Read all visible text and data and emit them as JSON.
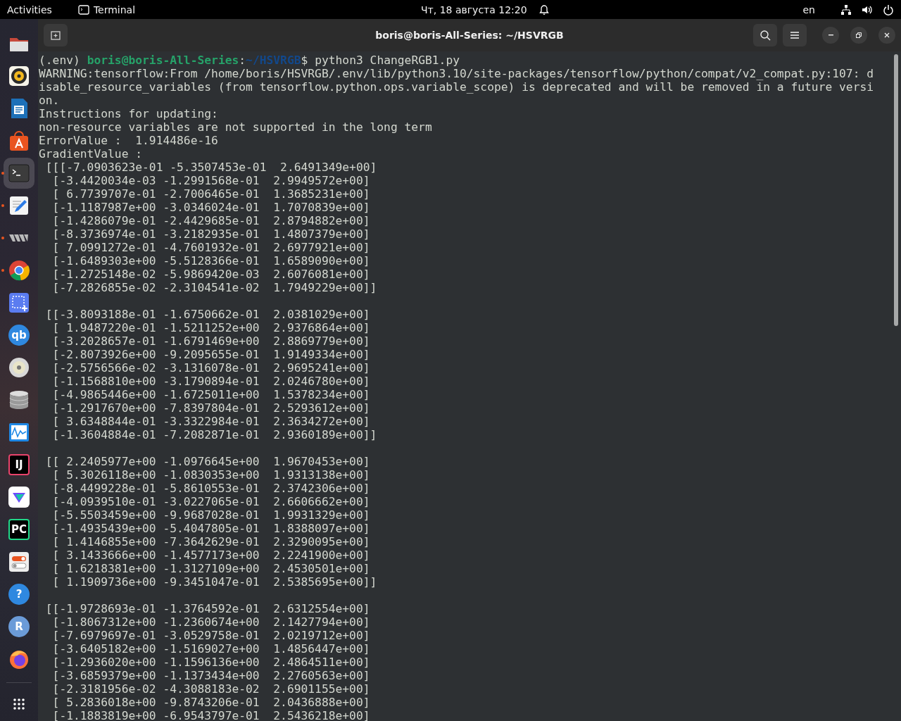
{
  "top_bar": {
    "activities": "Activities",
    "app_menu": "Terminal",
    "clock": "Чт, 18 августа  12:20",
    "keyboard_layout": "en"
  },
  "dock": {
    "items": [
      {
        "kind": "files",
        "running": false,
        "selected": false
      },
      {
        "kind": "music",
        "running": false,
        "selected": false
      },
      {
        "kind": "writer",
        "running": false,
        "selected": false
      },
      {
        "kind": "store",
        "running": false,
        "selected": false
      },
      {
        "kind": "terminal",
        "running": true,
        "selected": true
      },
      {
        "kind": "editor",
        "running": true,
        "selected": false
      },
      {
        "kind": "vm",
        "running": true,
        "selected": false
      },
      {
        "kind": "browser",
        "running": true,
        "selected": false
      },
      {
        "kind": "screenshot",
        "running": false,
        "selected": false
      },
      {
        "kind": "badge",
        "label": "qb",
        "running": false,
        "selected": false
      },
      {
        "kind": "disc",
        "running": false,
        "selected": false
      },
      {
        "kind": "database",
        "running": false,
        "selected": false
      },
      {
        "kind": "monitor",
        "running": false,
        "selected": false
      },
      {
        "kind": "ide",
        "label": "IJ",
        "running": false,
        "selected": false
      },
      {
        "kind": "vpn",
        "running": false,
        "selected": false
      },
      {
        "kind": "ide-green",
        "label": "PC",
        "running": false,
        "selected": false
      },
      {
        "kind": "toggles",
        "running": false,
        "selected": false
      },
      {
        "kind": "badge",
        "label": "?",
        "running": false,
        "selected": false
      },
      {
        "kind": "badge-light",
        "label": "R",
        "running": false,
        "selected": false
      },
      {
        "kind": "firefox",
        "running": false,
        "selected": false
      }
    ]
  },
  "window": {
    "title": "boris@boris-All-Series: ~/HSVRGB"
  },
  "terminal": {
    "prompt": {
      "env": "(.env)",
      "user_host": "boris@boris-All-Series",
      "separator": ":",
      "path": "~/HSVRGB",
      "symbol": "$",
      "command": "python3 ChangeRGB1.py"
    },
    "output": [
      "WARNING:tensorflow:From /home/boris/HSVRGB/.env/lib/python3.10/site-packages/tensorflow/python/compat/v2_compat.py:107: d",
      "isable_resource_variables (from tensorflow.python.ops.variable_scope) is deprecated and will be removed in a future versi",
      "on.",
      "Instructions for updating:",
      "non-resource variables are not supported in the long term",
      "ErrorValue :  1.914486e-16",
      "GradientValue :"
    ],
    "matrices": [
      [
        " [[[-7.0903623e-01 -5.3507453e-01  2.6491349e+00]",
        "  [-3.4420034e-03 -1.2991568e-01  2.9949572e+00]",
        "  [ 6.7739707e-01 -2.7006465e-01  1.3685231e+00]",
        "  [-1.1187987e+00 -3.0346024e-01  1.7070839e+00]",
        "  [-1.4286079e-01 -2.4429685e-01  2.8794882e+00]",
        "  [-8.3736974e-01 -3.2182935e-01  1.4807379e+00]",
        "  [ 7.0991272e-01 -4.7601932e-01  2.6977921e+00]",
        "  [-1.6489303e+00 -5.5128366e-01  1.6589090e+00]",
        "  [-1.2725148e-02 -5.9869420e-03  2.6076081e+00]",
        "  [-7.2826855e-02 -2.3104541e-02  1.7949229e+00]]"
      ],
      [
        " [[-3.8093188e-01 -1.6750662e-01  2.0381029e+00]",
        "  [ 1.9487220e-01 -1.5211252e+00  2.9376864e+00]",
        "  [-3.2028657e-01 -1.6791469e+00  2.8869779e+00]",
        "  [-2.8073926e+00 -9.2095655e-01  1.9149334e+00]",
        "  [-2.5756566e-02 -3.1316078e-01  2.9695241e+00]",
        "  [-1.1568810e+00 -3.1790894e-01  2.0246780e+00]",
        "  [-4.9865446e+00 -1.6725011e+00  1.5378234e+00]",
        "  [-1.2917670e+00 -7.8397804e-01  2.5293612e+00]",
        "  [ 3.6348844e-01 -3.3322984e-01  2.3634272e+00]",
        "  [-1.3604884e-01 -7.2082871e-01  2.9360189e+00]]"
      ],
      [
        " [[ 2.2405977e+00 -1.0976645e+00  1.9670453e+00]",
        "  [ 5.3026118e+00 -1.0830353e+00  1.9313138e+00]",
        "  [-8.4499228e-01 -5.8610553e-01  2.3742306e+00]",
        "  [-4.0939510e-01 -3.0227065e-01  2.6606662e+00]",
        "  [-5.5503459e+00 -9.9687028e-01  1.9931329e+00]",
        "  [-1.4935439e+00 -5.4047805e-01  1.8388097e+00]",
        "  [ 1.4146855e+00 -7.3642629e-01  2.3290095e+00]",
        "  [ 3.1433666e+00 -1.4577173e+00  2.2241900e+00]",
        "  [ 1.6218381e+00 -1.3127109e+00  2.4530501e+00]",
        "  [ 1.1909736e+00 -9.3451047e-01  2.5385695e+00]]"
      ],
      [
        " [[-1.9728693e-01 -1.3764592e-01  2.6312554e+00]",
        "  [-1.8067312e+00 -1.2360674e+00  2.1427794e+00]",
        "  [-7.6979697e-01 -3.0529758e-01  2.0219712e+00]",
        "  [-3.6405182e+00 -1.5169027e+00  1.4856447e+00]",
        "  [-1.2936020e+00 -1.1596136e+00  2.4864511e+00]",
        "  [-3.6859379e+00 -1.1373434e+00  2.2760563e+00]",
        "  [-2.3181956e-02 -4.3088183e-02  2.6901155e+00]",
        "  [ 5.2836018e+00 -9.8743206e-01  2.0436888e+00]",
        "  [-1.1883819e+00 -6.9543797e-01  2.5436218e+00]"
      ]
    ]
  }
}
